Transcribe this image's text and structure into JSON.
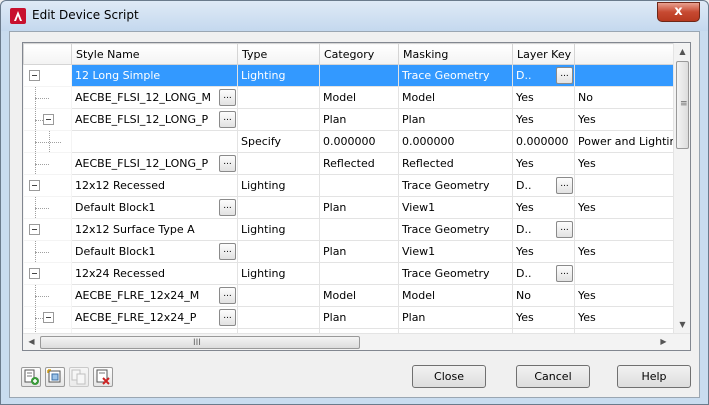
{
  "window": {
    "title": "Edit Device Script",
    "close_glyph": "x"
  },
  "grid": {
    "columns": [
      "",
      "Style Name",
      "Type",
      "Category",
      "Masking",
      "Layer Key",
      ""
    ],
    "rows": [
      {
        "level": 0,
        "box": true,
        "style": "12 Long Simple",
        "type": "Lighting",
        "type_btn": false,
        "category": "",
        "masking": "Trace Geometry",
        "layer_key": "D..",
        "layer_btn": true,
        "extra": "",
        "selected": true
      },
      {
        "level": 1,
        "box": false,
        "style": "AECBE_FLSI_12_LONG_M",
        "type": "",
        "type_btn": true,
        "category": "Model",
        "masking": "Model",
        "layer_key": "Yes",
        "layer_btn": false,
        "extra": "No",
        "selected": false
      },
      {
        "level": 1,
        "box": true,
        "style": "AECBE_FLSI_12_LONG_P",
        "type": "",
        "type_btn": true,
        "category": "Plan",
        "masking": "Plan",
        "layer_key": "Yes",
        "layer_btn": false,
        "extra": "Yes",
        "selected": false
      },
      {
        "level": 2,
        "box": false,
        "style": "",
        "type": "Specify",
        "type_btn": false,
        "category": "0.000000",
        "masking": "0.000000",
        "layer_key": "0.000000",
        "layer_btn": false,
        "extra": "Power and Lighting",
        "selected": false
      },
      {
        "level": 1,
        "box": false,
        "style": "AECBE_FLSI_12_LONG_P",
        "type": "",
        "type_btn": true,
        "category": "Reflected",
        "masking": "Reflected",
        "layer_key": "Yes",
        "layer_btn": false,
        "extra": "Yes",
        "selected": false
      },
      {
        "level": 0,
        "box": true,
        "style": "12x12 Recessed",
        "type": "Lighting",
        "type_btn": false,
        "category": "",
        "masking": "Trace Geometry",
        "layer_key": "D..",
        "layer_btn": true,
        "extra": "",
        "selected": false
      },
      {
        "level": 1,
        "box": false,
        "style": "Default Block1",
        "type": "",
        "type_btn": true,
        "category": "Plan",
        "masking": "View1",
        "layer_key": "Yes",
        "layer_btn": false,
        "extra": "Yes",
        "selected": false
      },
      {
        "level": 0,
        "box": true,
        "style": "12x12 Surface Type A",
        "type": "Lighting",
        "type_btn": false,
        "category": "",
        "masking": "Trace Geometry",
        "layer_key": "D..",
        "layer_btn": true,
        "extra": "",
        "selected": false
      },
      {
        "level": 1,
        "box": false,
        "style": "Default Block1",
        "type": "",
        "type_btn": true,
        "category": "Plan",
        "masking": "View1",
        "layer_key": "Yes",
        "layer_btn": false,
        "extra": "Yes",
        "selected": false
      },
      {
        "level": 0,
        "box": true,
        "style": "12x24 Recessed",
        "type": "Lighting",
        "type_btn": false,
        "category": "",
        "masking": "Trace Geometry",
        "layer_key": "D..",
        "layer_btn": true,
        "extra": "",
        "selected": false
      },
      {
        "level": 1,
        "box": false,
        "style": "AECBE_FLRE_12x24_M",
        "type": "",
        "type_btn": true,
        "category": "Model",
        "masking": "Model",
        "layer_key": "No",
        "layer_btn": false,
        "extra": "Yes",
        "selected": false
      },
      {
        "level": 1,
        "box": true,
        "style": "AECBE_FLRE_12x24_P",
        "type": "",
        "type_btn": true,
        "category": "Plan",
        "masking": "Plan",
        "layer_key": "Yes",
        "layer_btn": false,
        "extra": "Yes",
        "selected": false
      },
      {
        "level": 1,
        "box": false,
        "style": "",
        "type": "",
        "type_btn": false,
        "category": "",
        "masking": "",
        "layer_key": "",
        "layer_btn": false,
        "extra": "",
        "selected": false
      }
    ],
    "ellipsis_label": "...",
    "hscroll_grip": "III",
    "vscroll_grip": "≡"
  },
  "toolbar": {
    "icons": [
      "add-row-icon",
      "new-block-icon",
      "copy-row-icon",
      "delete-row-icon"
    ]
  },
  "buttons": {
    "close": "Close",
    "cancel": "Cancel",
    "help": "Help"
  },
  "colors": {
    "selection": "#3399ff",
    "title_close": "#c74a32",
    "app_icon": "#c8102e"
  }
}
